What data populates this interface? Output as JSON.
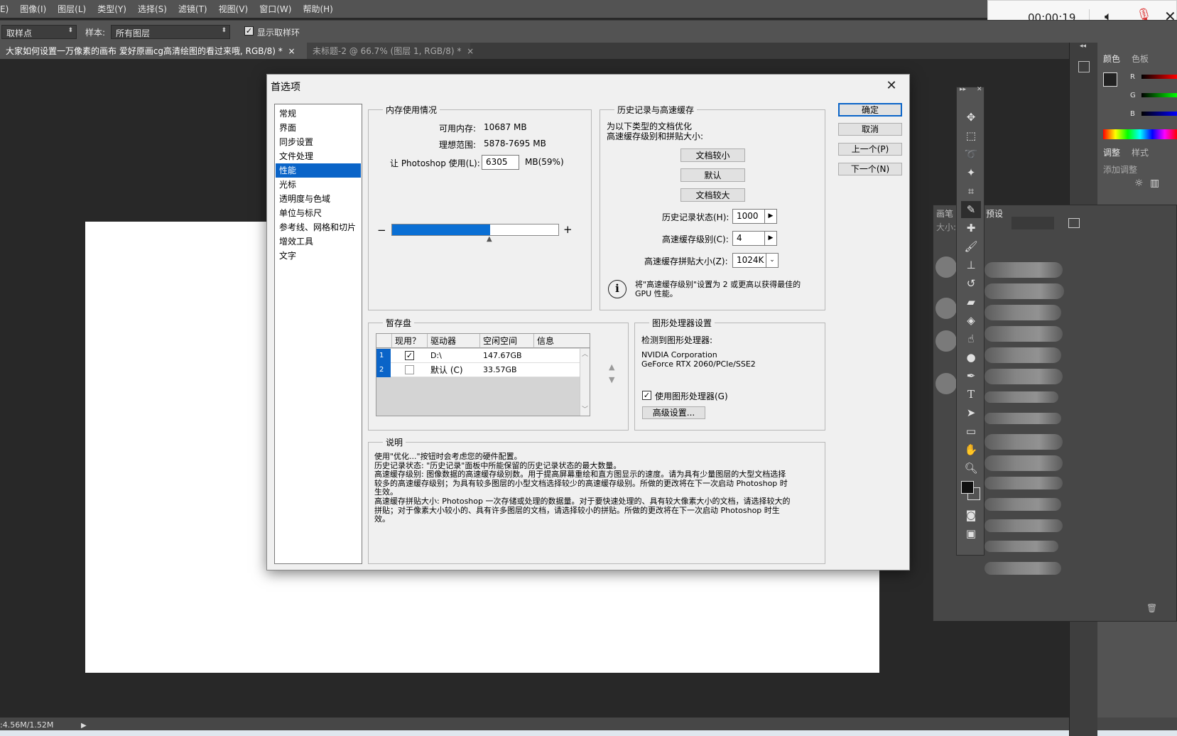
{
  "app": {
    "menu": [
      "E)",
      "图像(I)",
      "图层(L)",
      "类型(Y)",
      "选择(S)",
      "滤镜(T)",
      "视图(V)",
      "窗口(W)",
      "帮助(H)"
    ],
    "options": {
      "sample_point": "取样点",
      "sample_label": "样本:",
      "sample_value": "所有图层",
      "show_ring": "显示取样环"
    },
    "tabs": [
      {
        "label": "大家如何设置一万像素的画布 爱好原画cg高清绘图的看过来哦, RGB/8) *",
        "close": "×"
      },
      {
        "label": "未标题-2 @ 66.7% (图层 1, RGB/8) *",
        "close": "×"
      }
    ],
    "timer": "00:00:19",
    "status": ":4.56M/1.52M",
    "panels": {
      "color_tab": "颜色",
      "swatches_tab": "色板",
      "channels": [
        "R",
        "G",
        "B"
      ],
      "adjust_tab": "调整",
      "styles_tab": "样式",
      "add_adjustment": "添加调整",
      "brush_tab": "画笔",
      "brush_preset_tab": "预设",
      "size_label": "大小:"
    }
  },
  "dialog": {
    "title": "首选项",
    "nav": [
      "常规",
      "界面",
      "同步设置",
      "文件处理",
      "性能",
      "光标",
      "透明度与色域",
      "单位与标尺",
      "参考线、网格和切片",
      "增效工具",
      "文字"
    ],
    "selected_nav_index": 4,
    "memory": {
      "title": "内存使用情况",
      "available_label": "可用内存:",
      "available_value": "10687 MB",
      "ideal_label": "理想范围:",
      "ideal_value": "5878-7695 MB",
      "use_label": "让 Photoshop 使用(L):",
      "use_value": "6305",
      "use_suffix": "MB(59%)",
      "slider_fraction": 0.59,
      "minus": "−",
      "plus": "+"
    },
    "history": {
      "title": "历史记录与高速缓存",
      "intro_line1": "为以下类型的文档优化",
      "intro_line2": "高速缓存级别和拼贴大小:",
      "btn_small": "文档较小",
      "btn_default": "默认",
      "btn_large": "文档较大",
      "states_label": "历史记录状态(H):",
      "states_value": "1000",
      "levels_label": "高速缓存级别(C):",
      "levels_value": "4",
      "tile_label": "高速缓存拼贴大小(Z):",
      "tile_value": "1024K",
      "note_line1": "将\"高速缓存级别\"设置为 2 或更高以获得最佳的",
      "note_line2": "GPU 性能。"
    },
    "scratch": {
      "title": "暂存盘",
      "headers": [
        "现用？",
        "驱动器",
        "空闲空间",
        "信息"
      ],
      "rows": [
        {
          "num": "1",
          "checked": true,
          "drive": "D:\\",
          "free": "147.67GB",
          "info": ""
        },
        {
          "num": "2",
          "checked": false,
          "drive": "默认 (C)",
          "free": "33.57GB",
          "info": ""
        }
      ]
    },
    "gpu": {
      "title": "图形处理器设置",
      "detected_label": "检测到图形处理器:",
      "vendor": "NVIDIA Corporation",
      "model": "GeForce RTX 2060/PCIe/SSE2",
      "use_gpu_label": "使用图形处理器(G)",
      "advanced_btn": "高级设置..."
    },
    "description": {
      "title": "说明",
      "lines": [
        "使用\"优化...\"按钮时会考虑您的硬件配置。",
        "历史记录状态: \"历史记录\"面板中所能保留的历史记录状态的最大数量。",
        "高速缓存级别: 图像数据的高速缓存级别数。用于提高屏幕重绘和直方图显示的速度。请为具有少量图层的大型文档选择较多的高速缓存级别；为具有较多图层的小型文档选择较少的高速缓存级别。所做的更改将在下一次启动 Photoshop 时生效。",
        "高速缓存拼贴大小: Photoshop 一次存储或处理的数据量。对于要快速处理的、具有较大像素大小的文档，请选择较大的拼贴；对于像素大小较小的、具有许多图层的文档，请选择较小的拼贴。所做的更改将在下一次启动 Photoshop 时生效。"
      ]
    },
    "buttons": {
      "ok": "确定",
      "cancel": "取消",
      "prev": "上一个(P)",
      "next": "下一个(N)"
    }
  },
  "colors": {
    "accent": "#0a64c8",
    "ps_bg": "#282828",
    "ps_panel": "#535353"
  }
}
